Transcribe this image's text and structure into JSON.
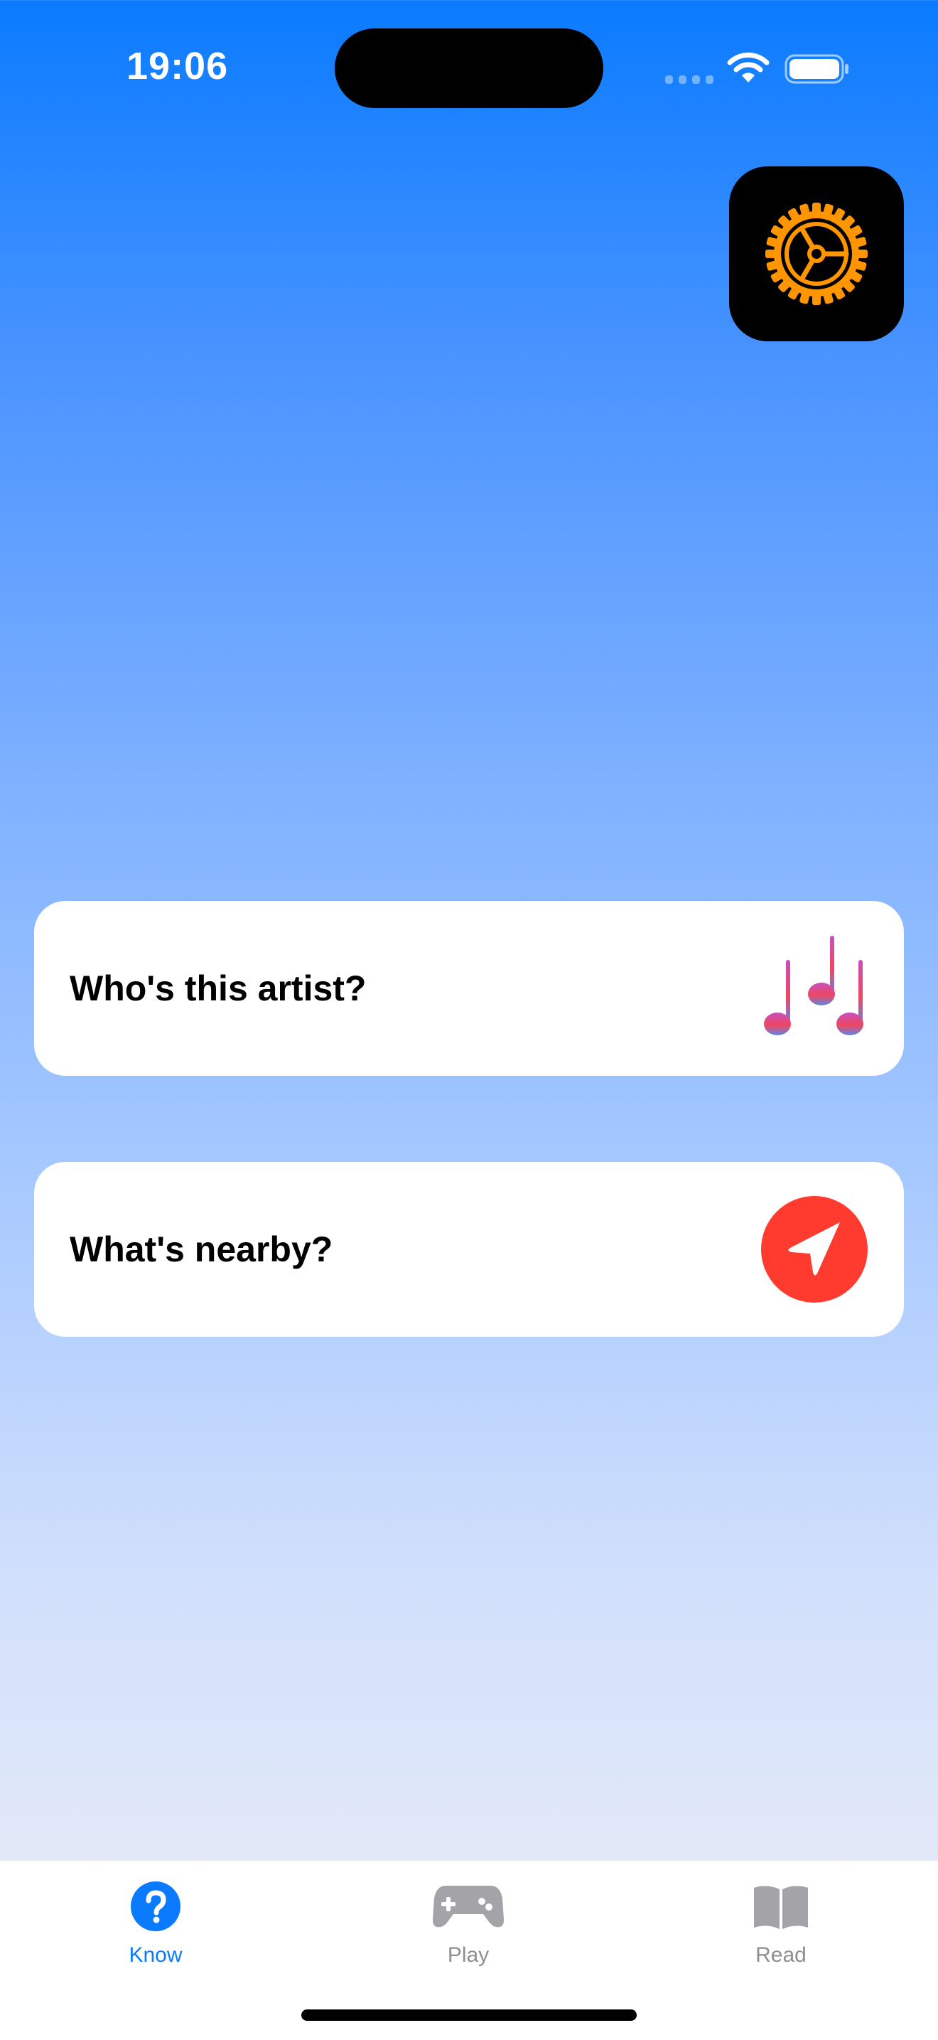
{
  "status_bar": {
    "time": "19:06"
  },
  "settings": {
    "icon": "gear-icon",
    "accent_color": "#ff9500"
  },
  "cards": [
    {
      "label": "Who's this artist?",
      "icon": "music-notes-icon"
    },
    {
      "label": "What's nearby?",
      "icon": "location-arrow-icon",
      "icon_color": "#ff3b30"
    }
  ],
  "tab_bar": {
    "active_color": "#0a7bff",
    "inactive_color": "#8e8e93",
    "tabs": [
      {
        "label": "Know",
        "icon": "question-circle-icon",
        "active": true
      },
      {
        "label": "Play",
        "icon": "gamepad-icon",
        "active": false
      },
      {
        "label": "Read",
        "icon": "book-icon",
        "active": false
      }
    ]
  }
}
